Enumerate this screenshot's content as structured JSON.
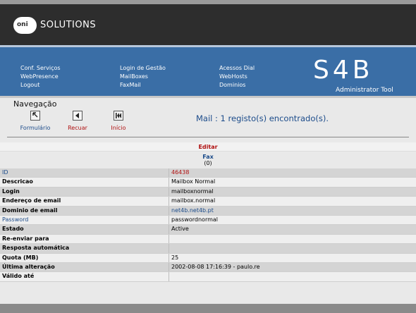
{
  "header": {
    "logo_badge": "oni",
    "logo_text": "SOLUTIONS"
  },
  "nav": {
    "col1": [
      "Conf. Serviços",
      "WebPresence",
      "Logout"
    ],
    "col2": [
      "Login de Gestão",
      "MailBoxes",
      "FaxMail"
    ],
    "col3": [
      "Acessos Dial",
      "WebHosts",
      "Dominios"
    ],
    "brand": "S4B",
    "brand_sub": "Administrator Tool"
  },
  "toolbar": {
    "title": "Navegação",
    "formulario": "Formulário",
    "recuar": "Recuar",
    "inicio": "Início"
  },
  "result_text": "Mail : 1 registo(s) encontrado(s).",
  "table": {
    "edit_label": "Editar",
    "fax_label": "Fax",
    "fax_count": "(0)",
    "rows": [
      {
        "label": "ID",
        "value": "46438"
      },
      {
        "label": "Descricao",
        "value": "Mailbox Normal"
      },
      {
        "label": "Login",
        "value": "mailboxnormal"
      },
      {
        "label": "Endereço de email",
        "value": "mailbox.normal"
      },
      {
        "label": "Dominio de email",
        "value": "net4b.net4b.pt"
      },
      {
        "label": "Password",
        "value": "passwordnormal"
      },
      {
        "label": "Estado",
        "value": "Active"
      },
      {
        "label": "Re-enviar para",
        "value": ""
      },
      {
        "label": "Resposta automática",
        "value": ""
      },
      {
        "label": "Quota (MB)",
        "value": "25"
      },
      {
        "label": "Última alteração",
        "value": "2002-08-08 17:16:39 - paulo.re"
      },
      {
        "label": "Válido até",
        "value": ""
      }
    ]
  },
  "colors": {
    "header_bg": "#2d2d2d",
    "nav_bg": "#3a6ea6",
    "link_blue": "#1b4b8a",
    "accent_red": "#b01010"
  }
}
